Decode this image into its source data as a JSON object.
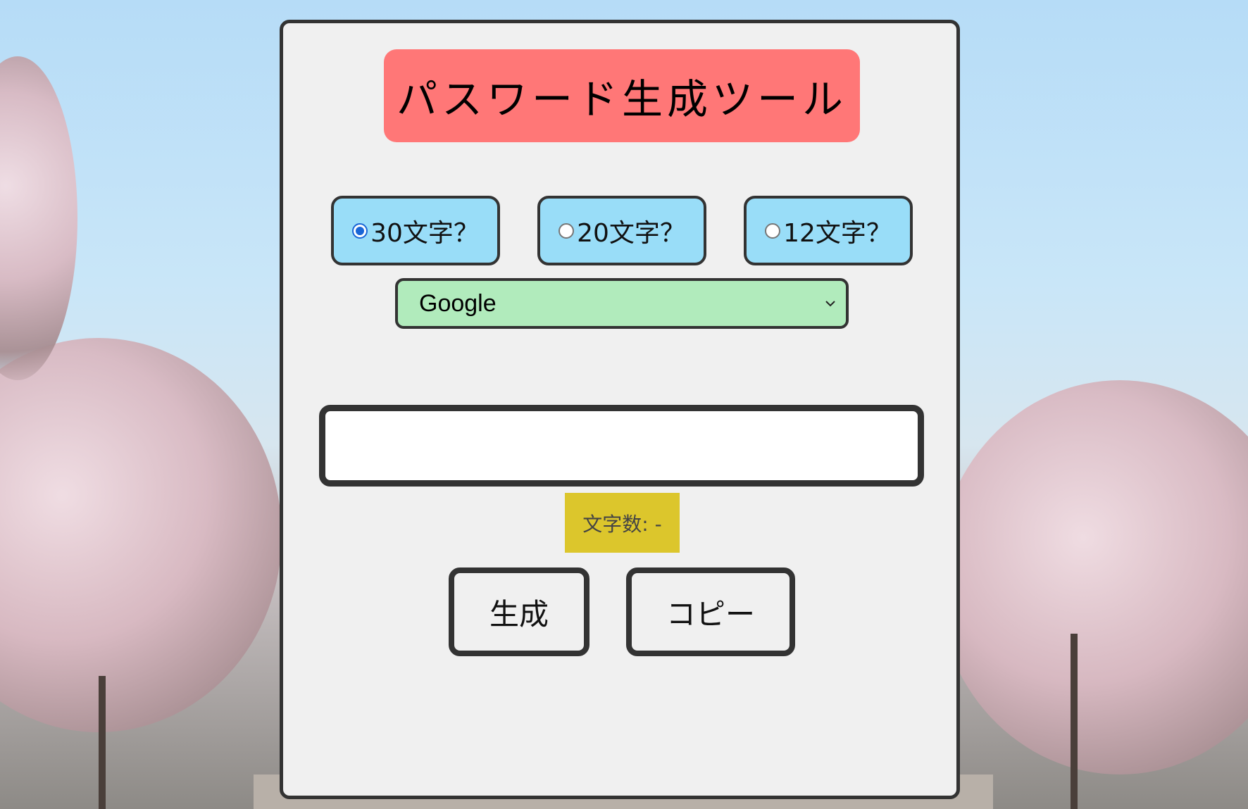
{
  "title": "パスワード生成ツール",
  "length_options": [
    {
      "label": "30文字？",
      "checked": true
    },
    {
      "label": "20文字？",
      "checked": false
    },
    {
      "label": "12文字？",
      "checked": false
    }
  ],
  "service_select": {
    "value": "Google"
  },
  "output": {
    "value": ""
  },
  "count": {
    "label": "文字数: -"
  },
  "buttons": {
    "generate": "生成",
    "copy": "コピー"
  },
  "colors": {
    "title_bg": "#ff7777",
    "radio_bg": "#99ddf8",
    "select_bg": "#b1ebbc",
    "count_bg": "#dcc62c",
    "panel_bg": "#f0f0f0",
    "border": "#333333"
  }
}
